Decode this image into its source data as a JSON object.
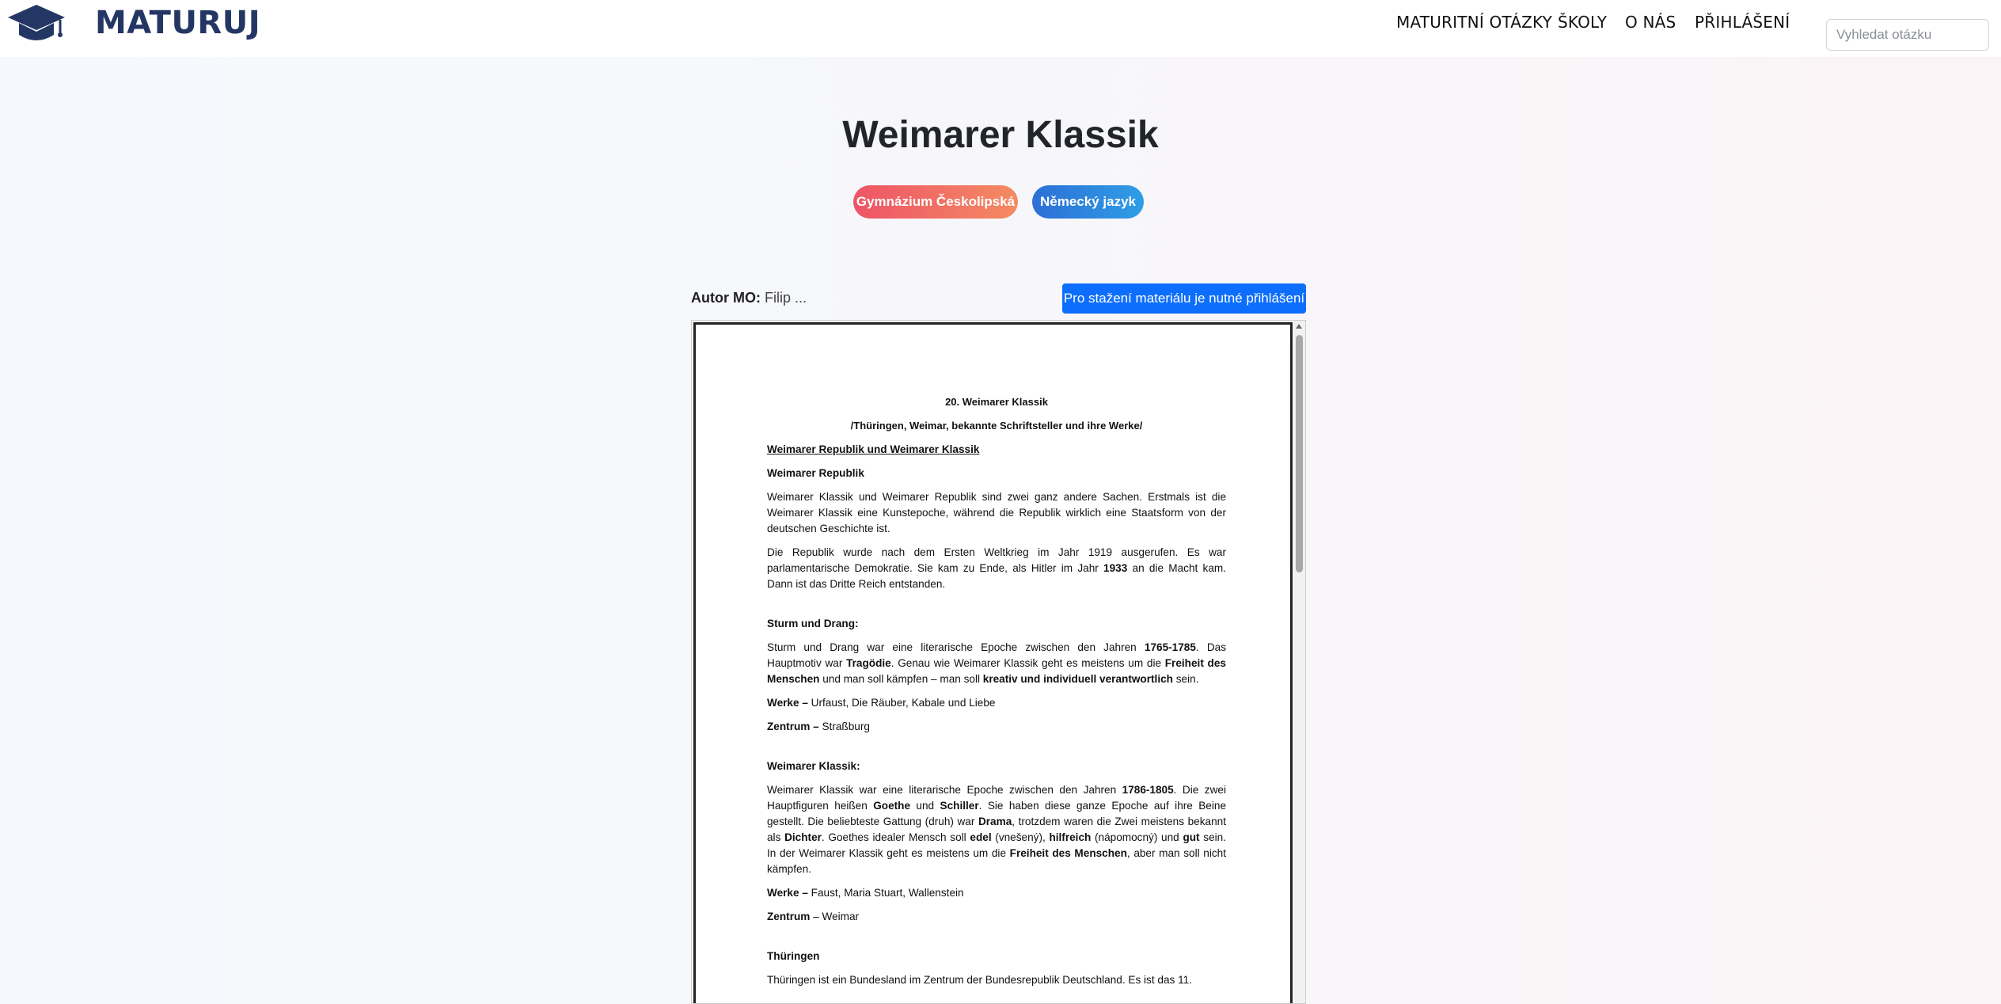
{
  "brand": {
    "name": "MATURUJ",
    "logo_icon": "graduation-cap-icon"
  },
  "nav": {
    "items": [
      "MATURITNÍ OTÁZKY",
      "ŠKOLY",
      "O NÁS",
      "PŘIHLÁŠENÍ"
    ],
    "search_placeholder": "Vyhledat otázku"
  },
  "page": {
    "title": "Weimarer Klassik",
    "badges": {
      "school": "Gymnázium Českolipská",
      "subject": "Německý jazyk"
    },
    "author_label": "Autor MO:",
    "author_name": "Filip ...",
    "download_button": "Pro stažení materiálu je nutné přihlášení"
  },
  "colors": {
    "brand": "#243664",
    "primary_button": "#0d6efd",
    "badge_school": "#ee5467",
    "badge_subject": "#2d6fd6"
  },
  "document": {
    "heading": "20. Weimarer Klassik",
    "subheading": "/Thüringen, Weimar, bekannte Schriftsteller und ihre Werke/",
    "section1_title": "Weimarer Republik und Weimarer Klassik",
    "section1_sub": "Weimarer Republik",
    "p1": "Weimarer Klassik und Weimarer Republik sind zwei ganz andere Sachen. Erstmals ist die Weimarer Klassik eine Kunstepoche, während die Republik wirklich eine Staatsform von der deutschen Geschichte ist.",
    "p2_a": "Die Republik wurde nach dem Ersten Weltkrieg im Jahr 1919 ausgerufen. Es war parlamentarische Demokratie. Sie kam zu Ende, als Hitler im Jahr ",
    "p2_b": "1933",
    "p2_c": " an die Macht kam. Dann ist das Dritte Reich entstanden.",
    "sd_title": "Sturm und Drang:",
    "sd_a": "Sturm und Drang war eine literarische Epoche zwischen den Jahren ",
    "sd_b": "1765-1785",
    "sd_c": ". Das Hauptmotiv war ",
    "sd_d": "Tragödie",
    "sd_e": ". Genau wie Weimarer Klassik geht es meistens um die ",
    "sd_f": "Freiheit des Menschen",
    "sd_g": " und man soll kämpfen – man soll ",
    "sd_h": "kreativ und individuell verantwortlich",
    "sd_i": " sein.",
    "sd_works_label": "Werke –",
    "sd_works": " Urfaust, Die Räuber, Kabale und Liebe",
    "sd_center_label": "Zentrum –",
    "sd_center": " Straßburg",
    "wk_title": "Weimarer Klassik:",
    "wk_a": "Weimarer Klassik war eine literarische Epoche zwischen den Jahren ",
    "wk_b": "1786-1805",
    "wk_c": ". Die zwei Hauptfiguren heißen ",
    "wk_d": "Goethe",
    "wk_e": " und ",
    "wk_f": "Schiller",
    "wk_g": ". Sie haben diese ganze Epoche auf ihre Beine gestellt. Die beliebteste Gattung (druh) war ",
    "wk_h": "Drama",
    "wk_i": ", trotzdem waren die Zwei meistens bekannt als ",
    "wk_j": "Dichter",
    "wk_k": ". Goethes idealer Mensch soll ",
    "wk_l": "edel",
    "wk_m": " (vnešený), ",
    "wk_n": "hilfreich",
    "wk_o": " (nápomocný) und ",
    "wk_p": "gut",
    "wk_q": " sein. In der Weimarer Klassik geht es meistens um die ",
    "wk_r": "Freiheit des Menschen",
    "wk_s": ", aber man soll nicht kämpfen.",
    "wk_works_label": "Werke –",
    "wk_works": " Faust, Maria Stuart, Wallenstein",
    "wk_center_label": "Zentrum",
    "wk_center": " – Weimar",
    "th_title": "Thüringen",
    "th_p": "Thüringen ist ein Bundesland im Zentrum der Bundesrepublik Deutschland. Es ist das 11."
  }
}
